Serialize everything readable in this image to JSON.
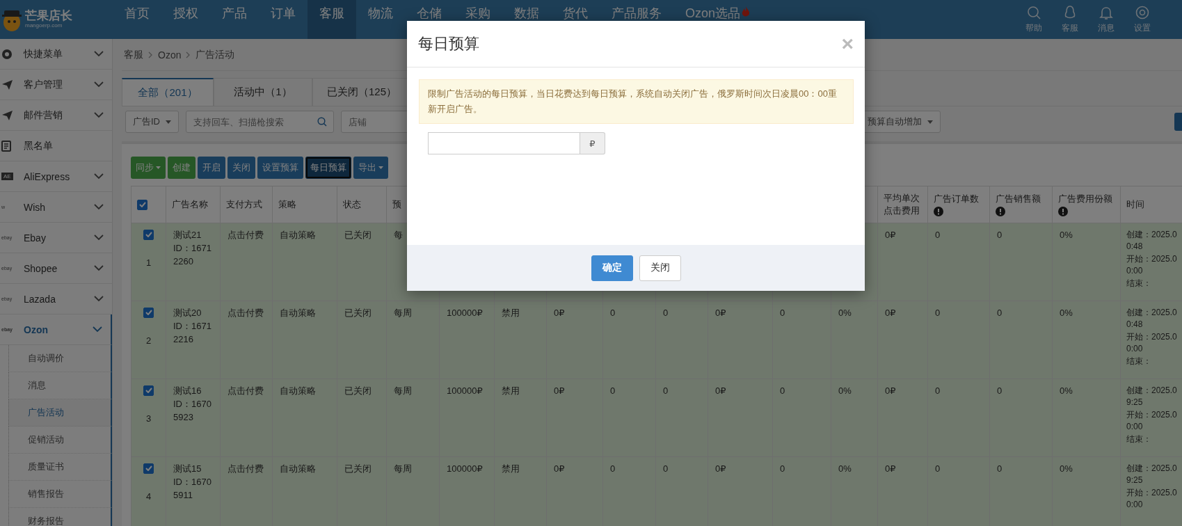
{
  "header": {
    "logo": {
      "title": "芒果店长",
      "subtitle": "mangoerp.com"
    },
    "nav": [
      {
        "label": "首页",
        "selected": false
      },
      {
        "label": "授权",
        "selected": false
      },
      {
        "label": "产品",
        "selected": false
      },
      {
        "label": "订单",
        "selected": false
      },
      {
        "label": "客服",
        "selected": true
      },
      {
        "label": "物流",
        "selected": false
      },
      {
        "label": "仓储",
        "selected": false
      },
      {
        "label": "采购",
        "selected": false
      },
      {
        "label": "数据",
        "selected": false
      },
      {
        "label": "货代",
        "selected": false
      },
      {
        "label": "产品服务",
        "selected": false
      },
      {
        "label": "Ozon选品",
        "selected": false,
        "hot": true
      }
    ],
    "tools": [
      {
        "label": "帮助",
        "kind": "search"
      },
      {
        "label": "客服",
        "kind": "support"
      },
      {
        "label": "消息",
        "kind": "bell"
      },
      {
        "label": "设置",
        "kind": "settings"
      }
    ]
  },
  "sidebar": {
    "items": [
      {
        "label": "快捷菜单",
        "kind": "gear",
        "expandable": true,
        "selected": false
      },
      {
        "label": "客户管理",
        "kind": "send",
        "expandable": true,
        "selected": false
      },
      {
        "label": "邮件营销",
        "kind": "send",
        "expandable": true,
        "selected": false
      },
      {
        "label": "黑名单",
        "kind": "list",
        "expandable": false,
        "selected": false
      },
      {
        "label": "AliExpress",
        "logo_text": "AE",
        "expandable": true,
        "selected": false
      },
      {
        "label": "Wish",
        "logo_text": "w",
        "expandable": true,
        "selected": false
      },
      {
        "label": "Ebay",
        "logo_text": "ebay",
        "expandable": true,
        "selected": false
      },
      {
        "label": "Shopee",
        "logo_text": "ebay",
        "expandable": true,
        "selected": false
      },
      {
        "label": "Lazada",
        "logo_text": "ebay",
        "expandable": true,
        "selected": false
      },
      {
        "label": "Ozon",
        "logo_text": "ebay",
        "expandable": true,
        "selected": true,
        "children": [
          {
            "label": "自动调价",
            "selected": false
          },
          {
            "label": "消息",
            "selected": false
          },
          {
            "label": "广告活动",
            "selected": true
          },
          {
            "label": "促销活动",
            "selected": false
          },
          {
            "label": "质量证书",
            "selected": false
          },
          {
            "label": "销售报告",
            "selected": false
          },
          {
            "label": "财务报告",
            "selected": false
          }
        ]
      }
    ]
  },
  "breadcrumb": [
    "客服",
    "Ozon",
    "广告活动"
  ],
  "tabs": [
    {
      "label": "全部（201）",
      "selected": true
    },
    {
      "label": "活动中（1）",
      "selected": false
    },
    {
      "label": "已关闭（125）",
      "selected": false
    }
  ],
  "filters": [
    {
      "kind": "select",
      "label": "广告ID"
    },
    {
      "kind": "search",
      "placeholder": "支持回车、扫描枪搜索"
    },
    {
      "kind": "input",
      "placeholder": "店铺"
    },
    {
      "kind": "select",
      "label": "预算自动增加"
    }
  ],
  "toolbar": [
    {
      "label": "同步",
      "kind": "success",
      "dropdown": true,
      "selected": false
    },
    {
      "label": "创建",
      "kind": "success",
      "dropdown": false,
      "selected": false
    },
    {
      "label": "开启",
      "kind": "primary",
      "dropdown": false,
      "selected": false
    },
    {
      "label": "关闭",
      "kind": "primary",
      "dropdown": false,
      "selected": false
    },
    {
      "label": "设置预算",
      "kind": "primary",
      "dropdown": false,
      "selected": false
    },
    {
      "label": "每日预算",
      "kind": "primary",
      "dropdown": false,
      "selected": true
    },
    {
      "label": "导出",
      "kind": "primary",
      "dropdown": true,
      "selected": false
    }
  ],
  "table": {
    "all_checked": true,
    "name_column": {
      "label": "广告名称"
    },
    "time_column": {
      "label": "时间"
    },
    "columns": [
      {
        "label": "支付方式",
        "info": false
      },
      {
        "label": "策略",
        "info": false
      },
      {
        "label": "状态",
        "info": false
      },
      {
        "label": "预",
        "info": false
      },
      null,
      null,
      null,
      null,
      null,
      null,
      null,
      null,
      {
        "label": "平均单次点击费用",
        "info": false
      },
      {
        "label": "广告订单数",
        "info": true
      },
      {
        "label": "广告销售额",
        "info": true
      },
      {
        "label": "广告费用份额",
        "info": true
      }
    ],
    "rows": [
      {
        "selected": true,
        "index": "1",
        "name": "测试21",
        "id": "ID：16712260",
        "cells": [
          "点击付费",
          "自动策略",
          "已关闭",
          "每",
          null,
          null,
          null,
          null,
          null,
          null,
          null,
          null,
          "0₽",
          "0",
          "0",
          "0%"
        ],
        "time": [
          "创建：2025.0",
          "0:48",
          "开始：2025.0",
          "0:00",
          "结束："
        ]
      },
      {
        "selected": true,
        "index": "2",
        "name": "测试20",
        "id": "ID：16712216",
        "cells": [
          "点击付费",
          "自动策略",
          "已关闭",
          "每周",
          "100000₽",
          "禁用",
          "0₽",
          "0",
          "0",
          "0₽",
          "0",
          "0%",
          "0₽",
          "0",
          "0",
          "0%"
        ],
        "time": [
          "创建：2025.0",
          "0:48",
          "开始：2025.0",
          "0:00",
          "结束："
        ]
      },
      {
        "selected": true,
        "index": "3",
        "name": "测试16",
        "id": "ID：16705923",
        "cells": [
          "点击付费",
          "自动策略",
          "已关闭",
          "每周",
          "100000₽",
          "禁用",
          "0₽",
          "0",
          "0",
          "0₽",
          "0",
          "0%",
          "0₽",
          "0",
          "0",
          "0%"
        ],
        "time": [
          "创建：2025.0",
          "9:25",
          "开始：2025.0",
          "0:00",
          "结束："
        ]
      },
      {
        "selected": true,
        "index": "4",
        "name": "测试15",
        "id": "ID：16705911",
        "cells": [
          "点击付费",
          "自动策略",
          "已关闭",
          "每周",
          "100000₽",
          "禁用",
          "0₽",
          "0",
          "0",
          "0₽",
          "0",
          "0%",
          "0₽",
          "0",
          "0",
          "0%"
        ],
        "time": [
          "创建：2025.0",
          "9:25",
          "开始：2025.0",
          "0:00"
        ]
      }
    ]
  },
  "modal": {
    "title": "每日预算",
    "close": "×",
    "alert": "限制广告活动的每日预算，当日花费达到每日预算，系统自动关闭广告，俄罗斯时间次日凌晨00：00重新开启广告。",
    "addon": "₽",
    "buttons": [
      {
        "label": "确定",
        "kind": "primary"
      },
      {
        "label": "关闭",
        "kind": "default"
      }
    ]
  }
}
